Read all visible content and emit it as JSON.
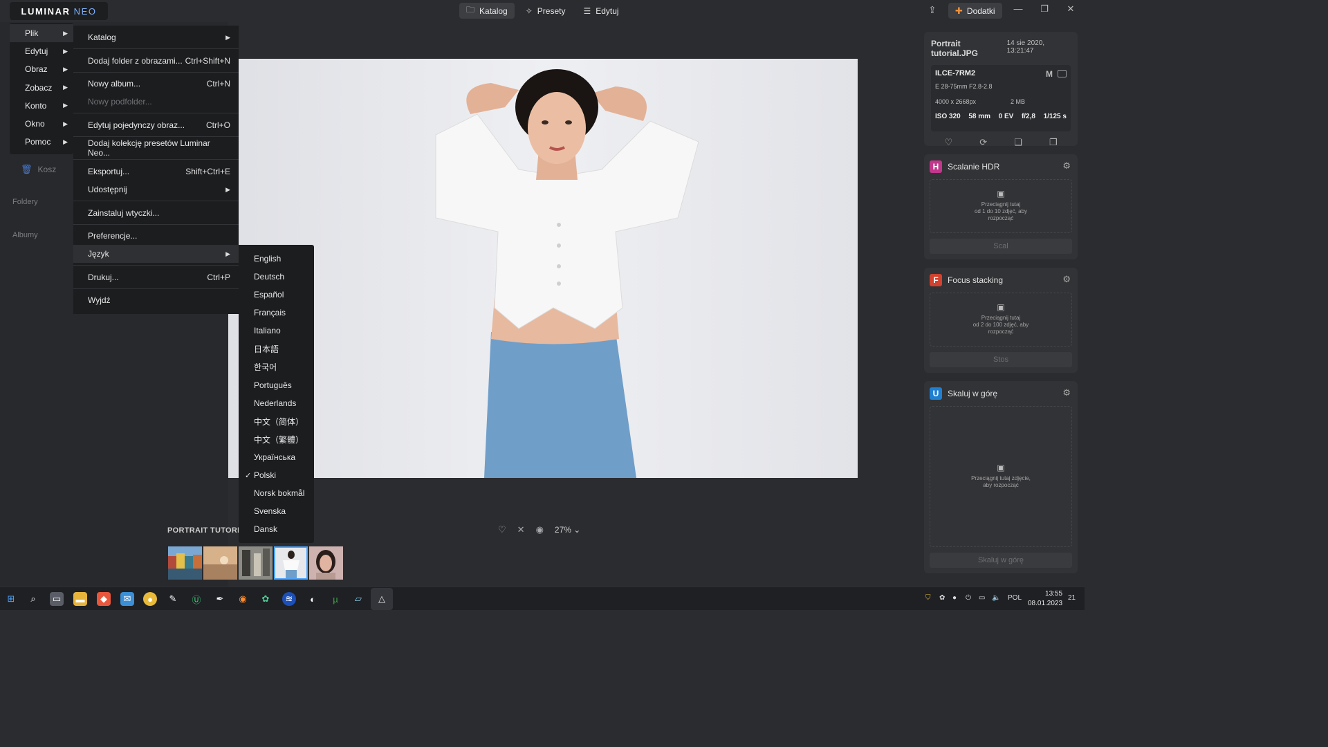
{
  "app": {
    "logo_main": "LUMINAR",
    "logo_accent": "NEO",
    "tabs": [
      {
        "label": "Katalog",
        "icon": "folder-icon"
      },
      {
        "label": "Presety",
        "icon": "sparkle-icon"
      },
      {
        "label": "Edytuj",
        "icon": "sliders-icon"
      }
    ],
    "addons_label": "Dodatki",
    "colors": {
      "accent": "#4aa3ff",
      "addons": "#f0913b",
      "menu_bg": "#1c1d1f"
    }
  },
  "sidebar": {
    "trash_label": "Kosz",
    "folders_label": "Foldery",
    "albums_label": "Albumy"
  },
  "main_menu": {
    "items": [
      {
        "label": "Plik"
      },
      {
        "label": "Edytuj"
      },
      {
        "label": "Obraz"
      },
      {
        "label": "Zobacz"
      },
      {
        "label": "Konto"
      },
      {
        "label": "Okno"
      },
      {
        "label": "Pomoc"
      }
    ]
  },
  "file_menu": {
    "items": [
      {
        "label": "Katalog",
        "shortcut": ""
      },
      {
        "label": "Dodaj folder z obrazami...",
        "shortcut": "Ctrl+Shift+N"
      },
      {
        "label": "Nowy album...",
        "shortcut": "Ctrl+N"
      },
      {
        "label": "Nowy podfolder...",
        "shortcut": ""
      },
      {
        "label": "Edytuj pojedynczy obraz...",
        "shortcut": "Ctrl+O"
      },
      {
        "label": "Dodaj kolekcję presetów Luminar Neo...",
        "shortcut": ""
      },
      {
        "label": "Eksportuj...",
        "shortcut": "Shift+Ctrl+E"
      },
      {
        "label": "Udostępnij",
        "shortcut": ""
      },
      {
        "label": "Zainstaluj wtyczki...",
        "shortcut": ""
      },
      {
        "label": "Preferencje...",
        "shortcut": ""
      },
      {
        "label": "Język",
        "shortcut": ""
      },
      {
        "label": "Drukuj...",
        "shortcut": "Ctrl+P"
      },
      {
        "label": "Wyjdź",
        "shortcut": ""
      }
    ]
  },
  "language_menu": {
    "selected_mark": "✓",
    "items": [
      "English",
      "Deutsch",
      "Español",
      "Français",
      "Italiano",
      "日本語",
      "한국어",
      "Português",
      "Nederlands",
      "中文（简体）",
      "中文（繁體）",
      "Українська",
      "Polski",
      "Norsk bokmål",
      "Svenska",
      "Dansk"
    ],
    "selected": "Polski"
  },
  "viewer": {
    "zoom": "27%",
    "filmstrip_title": "PORTRAIT TUTORIAL..."
  },
  "info": {
    "filename": "Portrait tutorial.JPG",
    "date": "14 sie 2020, 13:21:47",
    "camera": "ILCE-7RM2",
    "mode": "M",
    "lens": "E 28-75mm F2.8-2.8",
    "dimensions": "4000 x 2668px",
    "size": "2 MB",
    "iso": "ISO 320",
    "focal": "58 mm",
    "ev": "0 EV",
    "aperture": "f/2,8",
    "shutter": "1/125 s"
  },
  "tools": [
    {
      "badge": "H",
      "color": "#c2378c",
      "name": "Scalanie HDR",
      "hint1": "Przeciągnij tutaj",
      "hint2": "od 1 do 10 zdjęć, aby",
      "hint3": "rozpocząć",
      "button": "Scal"
    },
    {
      "badge": "F",
      "color": "#d2422e",
      "name": "Focus stacking",
      "hint1": "Przeciągnij tutaj",
      "hint2": "od 2 do 100 zdjęć, aby",
      "hint3": "rozpocząć",
      "button": "Stos"
    },
    {
      "badge": "U",
      "color": "#1f7fd1",
      "name": "Skaluj w górę",
      "hint1": "Przeciągnij tutaj zdjęcie,",
      "hint2": "aby rozpocząć",
      "hint3": "",
      "button": "Skaluj w górę"
    }
  ],
  "taskbar": {
    "lang": "POL",
    "time": "13:55",
    "date": "08.01.2023",
    "notifications": "21"
  }
}
